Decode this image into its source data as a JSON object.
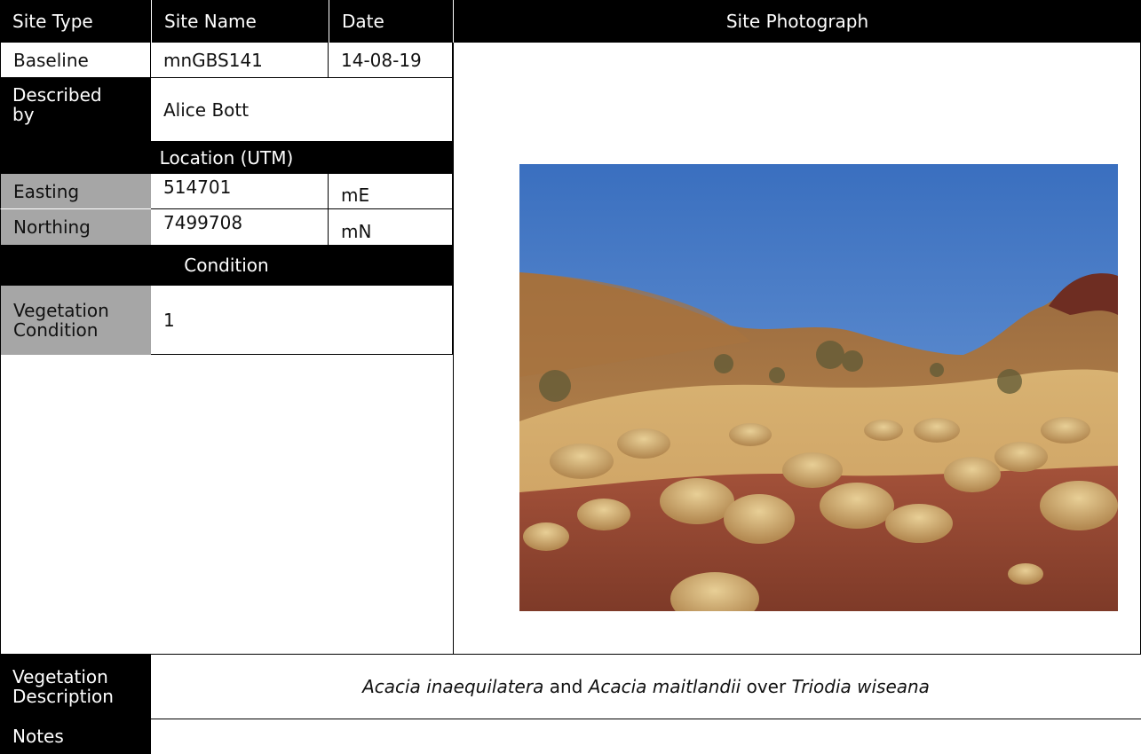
{
  "header": {
    "site_type": "Site Type",
    "site_name": "Site Name",
    "date": "Date",
    "site_photograph": "Site Photograph"
  },
  "site": {
    "type": "Baseline",
    "name": "mnGBS141",
    "date": "14-08-19"
  },
  "described_by": {
    "label": "Described by",
    "value": "Alice Bott"
  },
  "location": {
    "title": "Location (UTM)",
    "easting_label": "Easting",
    "easting_value": "514701",
    "easting_unit": "mE",
    "northing_label": "Northing",
    "northing_value": "7499708",
    "northing_unit": "mN"
  },
  "condition": {
    "title": "Condition",
    "label": "Vegetation Condition",
    "value": "1"
  },
  "vegetation": {
    "label": "Vegetation Description",
    "species_1": "Acacia inaequilatera",
    "and": "and",
    "species_2": "Acacia maitlandii",
    "over": "over",
    "species_3": "Triodia wiseana"
  },
  "notes": {
    "label": "Notes"
  }
}
